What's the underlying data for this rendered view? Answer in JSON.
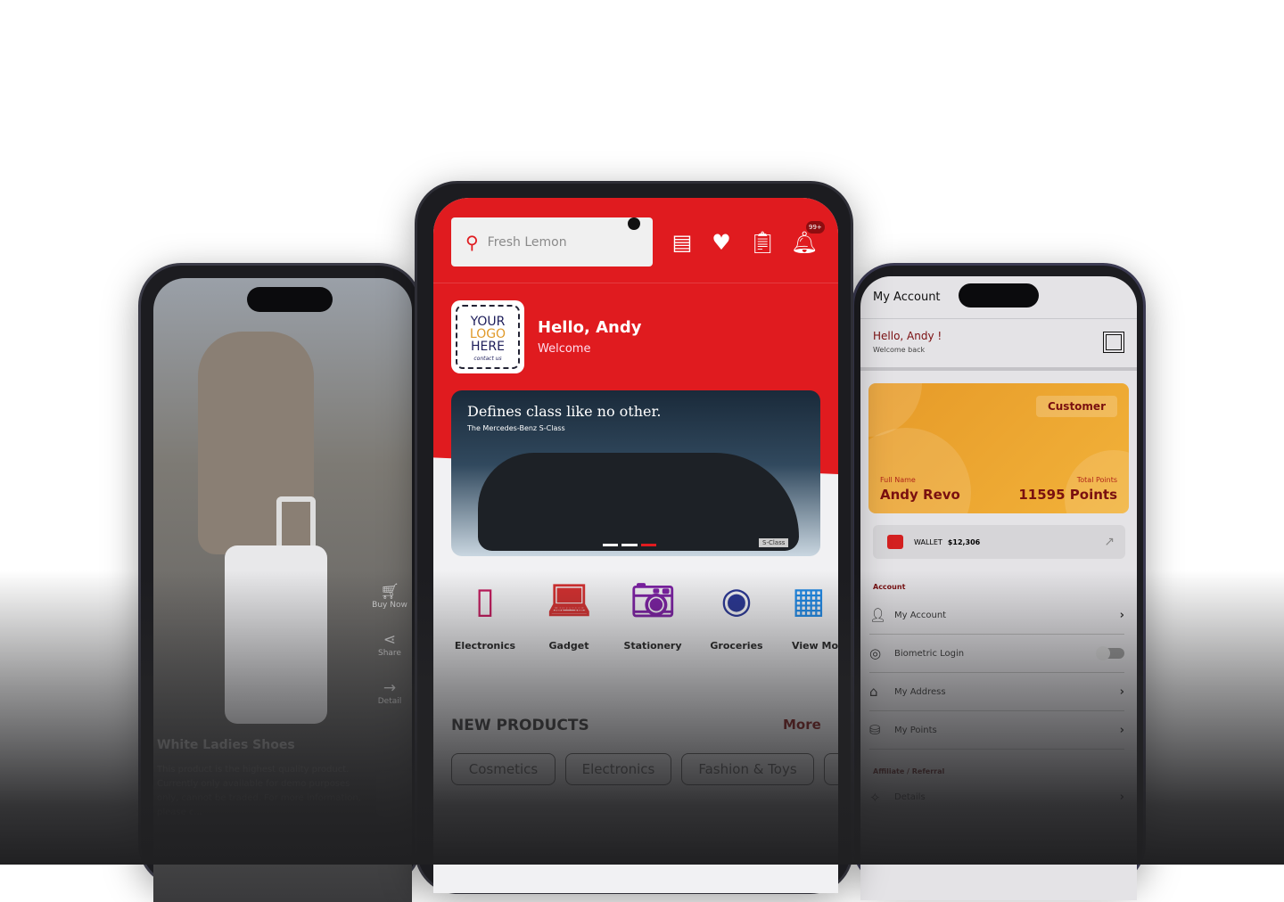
{
  "left_phone": {
    "actions": [
      {
        "icon": "cart-icon",
        "label": "Buy Now"
      },
      {
        "icon": "share-icon",
        "label": "Share"
      },
      {
        "icon": "arrow-right-icon",
        "label": "Detail"
      }
    ],
    "product_title": "White Ladies Shoes",
    "product_description": "This product is the highest quality product. Currently only available for demo purposes only, cannot be traded. For more information, please c..."
  },
  "center_phone": {
    "search": {
      "placeholder": "Fresh Lemon"
    },
    "notification_badge": "99+",
    "logo": {
      "line1": "YOUR",
      "line2": "LOGO",
      "line3": "HERE",
      "tag": "contact us"
    },
    "greeting": "Hello, Andy",
    "welcome": "Welcome",
    "banner": {
      "headline": "Defines class like no other.",
      "subline": "The Mercedes-Benz S-Class",
      "badge": "S-Class"
    },
    "categories": [
      {
        "label": "Electronics",
        "icon": "phone-icon",
        "color": "#c2185b"
      },
      {
        "label": "Gadget",
        "icon": "laptop-icon",
        "color": "#d32f2f"
      },
      {
        "label": "Stationery",
        "icon": "camera-icon",
        "color": "#7b1fa2"
      },
      {
        "label": "Groceries",
        "icon": "steering-wheel-icon",
        "color": "#283593"
      },
      {
        "label": "View More",
        "icon": "grid-icon",
        "color": "#1e88e5"
      }
    ],
    "section_title": "NEW PRODUCTS",
    "more_label": "More",
    "chips": [
      "Cosmetics",
      "Electronics",
      "Fashion & Toys"
    ],
    "brand_red": "#e01b1f"
  },
  "right_phone": {
    "title": "My Account",
    "hello": "Hello, Andy !",
    "welcome_back": "Welcome back",
    "card": {
      "role": "Customer",
      "name_label": "Full Name",
      "name": "Andy Revo",
      "points_label": "Total Points",
      "points": "11595 Points"
    },
    "wallet": {
      "label": "WALLET",
      "amount": "$12,306"
    },
    "section_account": "Account",
    "items": [
      {
        "label": "My Account",
        "icon": "person-icon"
      },
      {
        "label": "Biometric Login",
        "icon": "fingerprint-icon",
        "toggle": false
      },
      {
        "label": "My Address",
        "icon": "home-icon"
      },
      {
        "label": "My Points",
        "icon": "coins-icon"
      }
    ],
    "section_affiliate": "Affiliate / Referral",
    "affiliate_item": "Details"
  }
}
